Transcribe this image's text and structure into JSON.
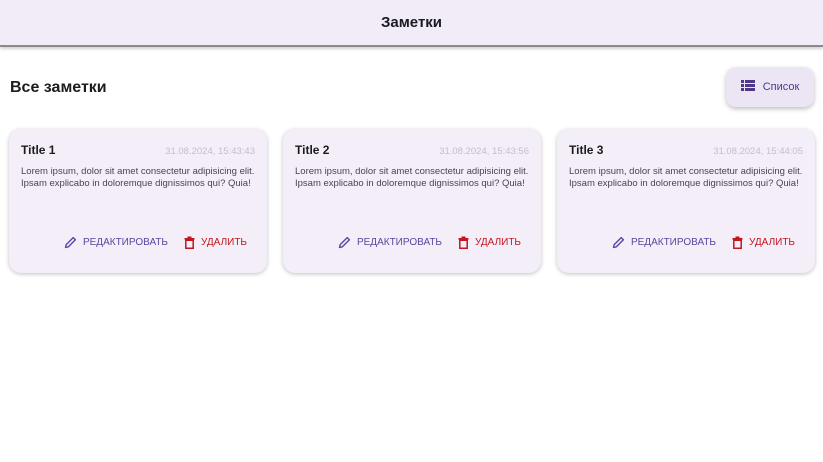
{
  "appbar": {
    "title": "Заметки"
  },
  "section": {
    "title": "Все заметки"
  },
  "view_toggle": {
    "label": "Список",
    "icon": "list-icon"
  },
  "colors": {
    "accent": "#5d45a0",
    "danger": "#c3161f",
    "appbar_bg": "#f1ecf7",
    "card_bg": "#f3eef8"
  },
  "notes": [
    {
      "title": "Title 1",
      "date": "31.08.2024, 15:43:43",
      "body": "Lorem ipsum, dolor sit amet consectetur adipisicing elit. Ipsam explicabo in doloremque dignissimos qui? Quia!",
      "edit_label": "РЕДАКТИРОВАТЬ",
      "delete_label": "УДАЛИТЬ"
    },
    {
      "title": "Title 2",
      "date": "31.08.2024, 15:43:56",
      "body": "Lorem ipsum, dolor sit amet consectetur adipisicing elit. Ipsam explicabo in doloremque dignissimos qui? Quia!",
      "edit_label": "РЕДАКТИРОВАТЬ",
      "delete_label": "УДАЛИТЬ"
    },
    {
      "title": "Title 3",
      "date": "31.08.2024, 15:44:05",
      "body": "Lorem ipsum, dolor sit amet consectetur adipisicing elit. Ipsam explicabo in doloremque dignissimos qui? Quia!",
      "edit_label": "РЕДАКТИРОВАТЬ",
      "delete_label": "УДАЛИТЬ"
    }
  ]
}
